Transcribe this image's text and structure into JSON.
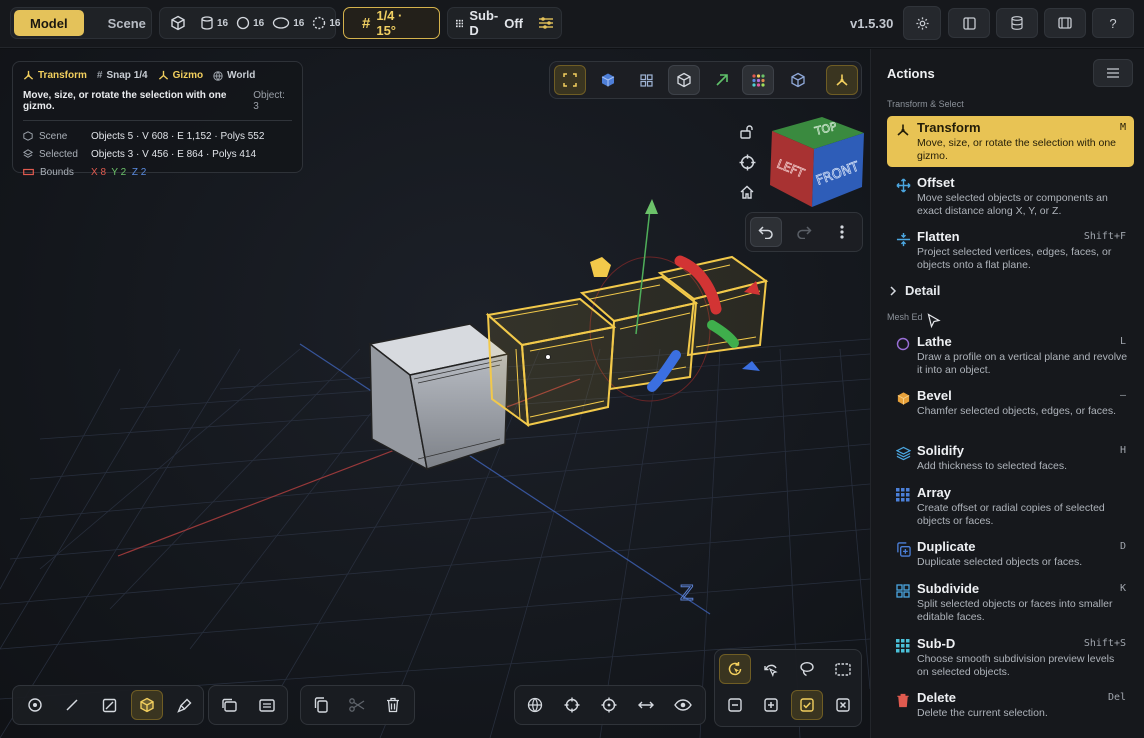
{
  "topbar": {
    "mode_tabs": [
      {
        "label": "Model",
        "active": true
      },
      {
        "label": "Scene",
        "active": false
      }
    ],
    "counters": [
      {
        "icon": "cube-icon",
        "value": ""
      },
      {
        "icon": "cylinder-icon",
        "value": "16"
      },
      {
        "icon": "sphere-icon",
        "value": "16"
      },
      {
        "icon": "torus-icon",
        "value": "16"
      },
      {
        "icon": "dotted-circle-icon",
        "value": "16"
      }
    ],
    "grid_snap": "1/4 · 15°",
    "subd_label": "Sub-D",
    "subd_state": "Off",
    "version": "v1.5.30",
    "help_label": "?"
  },
  "info": {
    "transform_label": "Transform",
    "snap_label": "Snap 1/4",
    "gizmo_label": "Gizmo",
    "world_label": "World",
    "description": "Move, size, or rotate the selection with one gizmo.",
    "object_count": "Object: 3",
    "stats": [
      {
        "label": "Scene",
        "value": "Objects 5 · V 608 · E 1,152 · Polys 552"
      },
      {
        "label": "Selected",
        "value": "Objects 3 · V 456 · E 864 · Polys 414"
      }
    ],
    "bounds_label": "Bounds",
    "bounds_x": "X 8",
    "bounds_y": "Y 2",
    "bounds_z": "Z 2"
  },
  "viewcube": {
    "top": "TOP",
    "left": "LEFT",
    "front": "FRONT"
  },
  "axis_label_z": "Z",
  "panel": {
    "title": "Actions",
    "section_transform": "Transform & Select",
    "detail_label": "Detail",
    "section_mesh": "Mesh Ed",
    "actions": [
      {
        "title": "Transform",
        "desc": "Move, size, or rotate the selection with one gizmo.",
        "key": "M",
        "icon": "transform-icon",
        "selected": true
      },
      {
        "title": "Offset",
        "desc": "Move selected objects or components an exact distance along X, Y, or Z.",
        "key": "",
        "icon": "move-arrows-icon"
      },
      {
        "title": "Flatten",
        "desc": "Project selected vertices, edges, faces, or objects onto a flat plane.",
        "key": "Shift+F",
        "icon": "flatten-icon"
      },
      {
        "title": "Lathe",
        "desc": "Draw a profile on a vertical plane and revolve it into an object.",
        "key": "L",
        "icon": "lathe-icon"
      },
      {
        "title": "Bevel",
        "desc": "Chamfer selected objects, edges, or faces.",
        "key": "–",
        "icon": "bevel-icon"
      },
      {
        "title": "Solidify",
        "desc": "Add thickness to selected faces.",
        "key": "H",
        "icon": "layers-icon"
      },
      {
        "title": "Array",
        "desc": "Create offset or radial copies of selected objects or faces.",
        "key": "",
        "icon": "array-grid-icon"
      },
      {
        "title": "Duplicate",
        "desc": "Duplicate selected objects or faces.",
        "key": "D",
        "icon": "duplicate-icon"
      },
      {
        "title": "Subdivide",
        "desc": "Split selected objects or faces into smaller editable faces.",
        "key": "K",
        "icon": "subdivide-icon"
      },
      {
        "title": "Sub-D",
        "desc": "Choose smooth subdivision preview levels on selected objects.",
        "key": "Shift+S",
        "icon": "subd-grid-icon"
      },
      {
        "title": "Delete",
        "desc": "Delete the current selection.",
        "key": "Del",
        "icon": "trash-icon"
      }
    ]
  },
  "colors": {
    "accent": "#e8c354",
    "x_axis": "#e05a4f",
    "y_axis": "#6cc26a",
    "z_axis": "#5a8be0"
  }
}
